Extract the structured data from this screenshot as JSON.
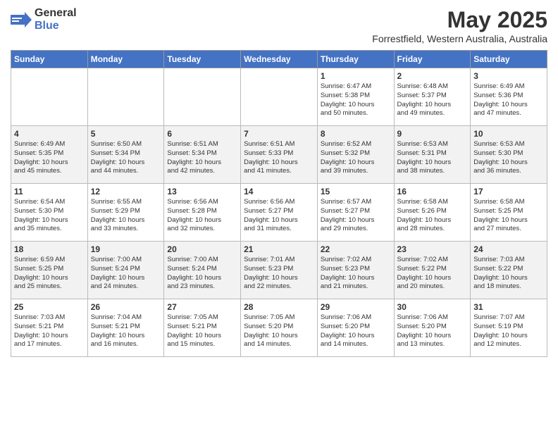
{
  "header": {
    "logo_line1": "General",
    "logo_line2": "Blue",
    "title": "May 2025",
    "subtitle": "Forrestfield, Western Australia, Australia"
  },
  "days_of_week": [
    "Sunday",
    "Monday",
    "Tuesday",
    "Wednesday",
    "Thursday",
    "Friday",
    "Saturday"
  ],
  "weeks": [
    [
      {
        "num": "",
        "info": ""
      },
      {
        "num": "",
        "info": ""
      },
      {
        "num": "",
        "info": ""
      },
      {
        "num": "",
        "info": ""
      },
      {
        "num": "1",
        "info": "Sunrise: 6:47 AM\nSunset: 5:38 PM\nDaylight: 10 hours\nand 50 minutes."
      },
      {
        "num": "2",
        "info": "Sunrise: 6:48 AM\nSunset: 5:37 PM\nDaylight: 10 hours\nand 49 minutes."
      },
      {
        "num": "3",
        "info": "Sunrise: 6:49 AM\nSunset: 5:36 PM\nDaylight: 10 hours\nand 47 minutes."
      }
    ],
    [
      {
        "num": "4",
        "info": "Sunrise: 6:49 AM\nSunset: 5:35 PM\nDaylight: 10 hours\nand 45 minutes."
      },
      {
        "num": "5",
        "info": "Sunrise: 6:50 AM\nSunset: 5:34 PM\nDaylight: 10 hours\nand 44 minutes."
      },
      {
        "num": "6",
        "info": "Sunrise: 6:51 AM\nSunset: 5:34 PM\nDaylight: 10 hours\nand 42 minutes."
      },
      {
        "num": "7",
        "info": "Sunrise: 6:51 AM\nSunset: 5:33 PM\nDaylight: 10 hours\nand 41 minutes."
      },
      {
        "num": "8",
        "info": "Sunrise: 6:52 AM\nSunset: 5:32 PM\nDaylight: 10 hours\nand 39 minutes."
      },
      {
        "num": "9",
        "info": "Sunrise: 6:53 AM\nSunset: 5:31 PM\nDaylight: 10 hours\nand 38 minutes."
      },
      {
        "num": "10",
        "info": "Sunrise: 6:53 AM\nSunset: 5:30 PM\nDaylight: 10 hours\nand 36 minutes."
      }
    ],
    [
      {
        "num": "11",
        "info": "Sunrise: 6:54 AM\nSunset: 5:30 PM\nDaylight: 10 hours\nand 35 minutes."
      },
      {
        "num": "12",
        "info": "Sunrise: 6:55 AM\nSunset: 5:29 PM\nDaylight: 10 hours\nand 33 minutes."
      },
      {
        "num": "13",
        "info": "Sunrise: 6:56 AM\nSunset: 5:28 PM\nDaylight: 10 hours\nand 32 minutes."
      },
      {
        "num": "14",
        "info": "Sunrise: 6:56 AM\nSunset: 5:27 PM\nDaylight: 10 hours\nand 31 minutes."
      },
      {
        "num": "15",
        "info": "Sunrise: 6:57 AM\nSunset: 5:27 PM\nDaylight: 10 hours\nand 29 minutes."
      },
      {
        "num": "16",
        "info": "Sunrise: 6:58 AM\nSunset: 5:26 PM\nDaylight: 10 hours\nand 28 minutes."
      },
      {
        "num": "17",
        "info": "Sunrise: 6:58 AM\nSunset: 5:25 PM\nDaylight: 10 hours\nand 27 minutes."
      }
    ],
    [
      {
        "num": "18",
        "info": "Sunrise: 6:59 AM\nSunset: 5:25 PM\nDaylight: 10 hours\nand 25 minutes."
      },
      {
        "num": "19",
        "info": "Sunrise: 7:00 AM\nSunset: 5:24 PM\nDaylight: 10 hours\nand 24 minutes."
      },
      {
        "num": "20",
        "info": "Sunrise: 7:00 AM\nSunset: 5:24 PM\nDaylight: 10 hours\nand 23 minutes."
      },
      {
        "num": "21",
        "info": "Sunrise: 7:01 AM\nSunset: 5:23 PM\nDaylight: 10 hours\nand 22 minutes."
      },
      {
        "num": "22",
        "info": "Sunrise: 7:02 AM\nSunset: 5:23 PM\nDaylight: 10 hours\nand 21 minutes."
      },
      {
        "num": "23",
        "info": "Sunrise: 7:02 AM\nSunset: 5:22 PM\nDaylight: 10 hours\nand 20 minutes."
      },
      {
        "num": "24",
        "info": "Sunrise: 7:03 AM\nSunset: 5:22 PM\nDaylight: 10 hours\nand 18 minutes."
      }
    ],
    [
      {
        "num": "25",
        "info": "Sunrise: 7:03 AM\nSunset: 5:21 PM\nDaylight: 10 hours\nand 17 minutes."
      },
      {
        "num": "26",
        "info": "Sunrise: 7:04 AM\nSunset: 5:21 PM\nDaylight: 10 hours\nand 16 minutes."
      },
      {
        "num": "27",
        "info": "Sunrise: 7:05 AM\nSunset: 5:21 PM\nDaylight: 10 hours\nand 15 minutes."
      },
      {
        "num": "28",
        "info": "Sunrise: 7:05 AM\nSunset: 5:20 PM\nDaylight: 10 hours\nand 14 minutes."
      },
      {
        "num": "29",
        "info": "Sunrise: 7:06 AM\nSunset: 5:20 PM\nDaylight: 10 hours\nand 14 minutes."
      },
      {
        "num": "30",
        "info": "Sunrise: 7:06 AM\nSunset: 5:20 PM\nDaylight: 10 hours\nand 13 minutes."
      },
      {
        "num": "31",
        "info": "Sunrise: 7:07 AM\nSunset: 5:19 PM\nDaylight: 10 hours\nand 12 minutes."
      }
    ]
  ]
}
